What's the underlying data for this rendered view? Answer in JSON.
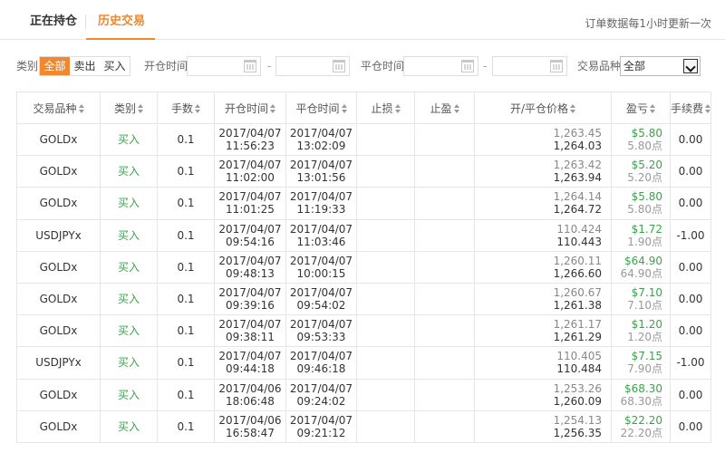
{
  "tabs": [
    {
      "label": "正在持仓",
      "active": false
    },
    {
      "label": "历史交易",
      "active": true
    }
  ],
  "update_note": "订单数据每1小时更新一次",
  "accent_color": "#f0892d",
  "profit_color": "#3aa34a",
  "filters": {
    "type_label": "类别",
    "type_options": [
      "全部",
      "卖出",
      "买入"
    ],
    "type_selected": "全部",
    "open_time_label": "开仓时间",
    "close_time_label": "平仓时间",
    "range_sep": "-",
    "symbol_label": "交易品种",
    "symbol_selected": "全部"
  },
  "columns": [
    "交易品种",
    "类别",
    "手数",
    "开仓时间",
    "平仓时间",
    "止损",
    "止盈",
    "开/平仓价格",
    "盈亏",
    "手续费"
  ],
  "rows": [
    {
      "symbol": "GOLDx",
      "type": "买入",
      "lots": "0.1",
      "open_date": "2017/04/07",
      "open_time": "11:56:23",
      "close_date": "2017/04/07",
      "close_time": "13:02:09",
      "sl": "",
      "tp": "",
      "open_price": "1,263.45",
      "close_price": "1,264.03",
      "pl": "$5.80",
      "pl_points": "5.80点",
      "fee": "0.00"
    },
    {
      "symbol": "GOLDx",
      "type": "买入",
      "lots": "0.1",
      "open_date": "2017/04/07",
      "open_time": "11:02:00",
      "close_date": "2017/04/07",
      "close_time": "13:01:56",
      "sl": "",
      "tp": "",
      "open_price": "1,263.42",
      "close_price": "1,263.94",
      "pl": "$5.20",
      "pl_points": "5.20点",
      "fee": "0.00"
    },
    {
      "symbol": "GOLDx",
      "type": "买入",
      "lots": "0.1",
      "open_date": "2017/04/07",
      "open_time": "11:01:25",
      "close_date": "2017/04/07",
      "close_time": "11:19:33",
      "sl": "",
      "tp": "",
      "open_price": "1,264.14",
      "close_price": "1,264.72",
      "pl": "$5.80",
      "pl_points": "5.80点",
      "fee": "0.00"
    },
    {
      "symbol": "USDJPYx",
      "type": "买入",
      "lots": "0.1",
      "open_date": "2017/04/07",
      "open_time": "09:54:16",
      "close_date": "2017/04/07",
      "close_time": "11:03:46",
      "sl": "",
      "tp": "",
      "open_price": "110.424",
      "close_price": "110.443",
      "pl": "$1.72",
      "pl_points": "1.90点",
      "fee": "-1.00"
    },
    {
      "symbol": "GOLDx",
      "type": "买入",
      "lots": "0.1",
      "open_date": "2017/04/07",
      "open_time": "09:48:13",
      "close_date": "2017/04/07",
      "close_time": "10:00:15",
      "sl": "",
      "tp": "",
      "open_price": "1,260.11",
      "close_price": "1,266.60",
      "pl": "$64.90",
      "pl_points": "64.90点",
      "fee": "0.00"
    },
    {
      "symbol": "GOLDx",
      "type": "买入",
      "lots": "0.1",
      "open_date": "2017/04/07",
      "open_time": "09:39:16",
      "close_date": "2017/04/07",
      "close_time": "09:54:02",
      "sl": "",
      "tp": "",
      "open_price": "1,260.67",
      "close_price": "1,261.38",
      "pl": "$7.10",
      "pl_points": "7.10点",
      "fee": "0.00"
    },
    {
      "symbol": "GOLDx",
      "type": "买入",
      "lots": "0.1",
      "open_date": "2017/04/07",
      "open_time": "09:38:11",
      "close_date": "2017/04/07",
      "close_time": "09:53:33",
      "sl": "",
      "tp": "",
      "open_price": "1,261.17",
      "close_price": "1,261.29",
      "pl": "$1.20",
      "pl_points": "1.20点",
      "fee": "0.00"
    },
    {
      "symbol": "USDJPYx",
      "type": "买入",
      "lots": "0.1",
      "open_date": "2017/04/07",
      "open_time": "09:44:18",
      "close_date": "2017/04/07",
      "close_time": "09:46:18",
      "sl": "",
      "tp": "",
      "open_price": "110.405",
      "close_price": "110.484",
      "pl": "$7.15",
      "pl_points": "7.90点",
      "fee": "-1.00"
    },
    {
      "symbol": "GOLDx",
      "type": "买入",
      "lots": "0.1",
      "open_date": "2017/04/06",
      "open_time": "18:06:48",
      "close_date": "2017/04/07",
      "close_time": "09:24:02",
      "sl": "",
      "tp": "",
      "open_price": "1,253.26",
      "close_price": "1,260.09",
      "pl": "$68.30",
      "pl_points": "68.30点",
      "fee": "0.00"
    },
    {
      "symbol": "GOLDx",
      "type": "买入",
      "lots": "0.1",
      "open_date": "2017/04/06",
      "open_time": "16:58:47",
      "close_date": "2017/04/07",
      "close_time": "09:21:12",
      "sl": "",
      "tp": "",
      "open_price": "1,254.13",
      "close_price": "1,256.35",
      "pl": "$22.20",
      "pl_points": "22.20点",
      "fee": "0.00"
    }
  ]
}
